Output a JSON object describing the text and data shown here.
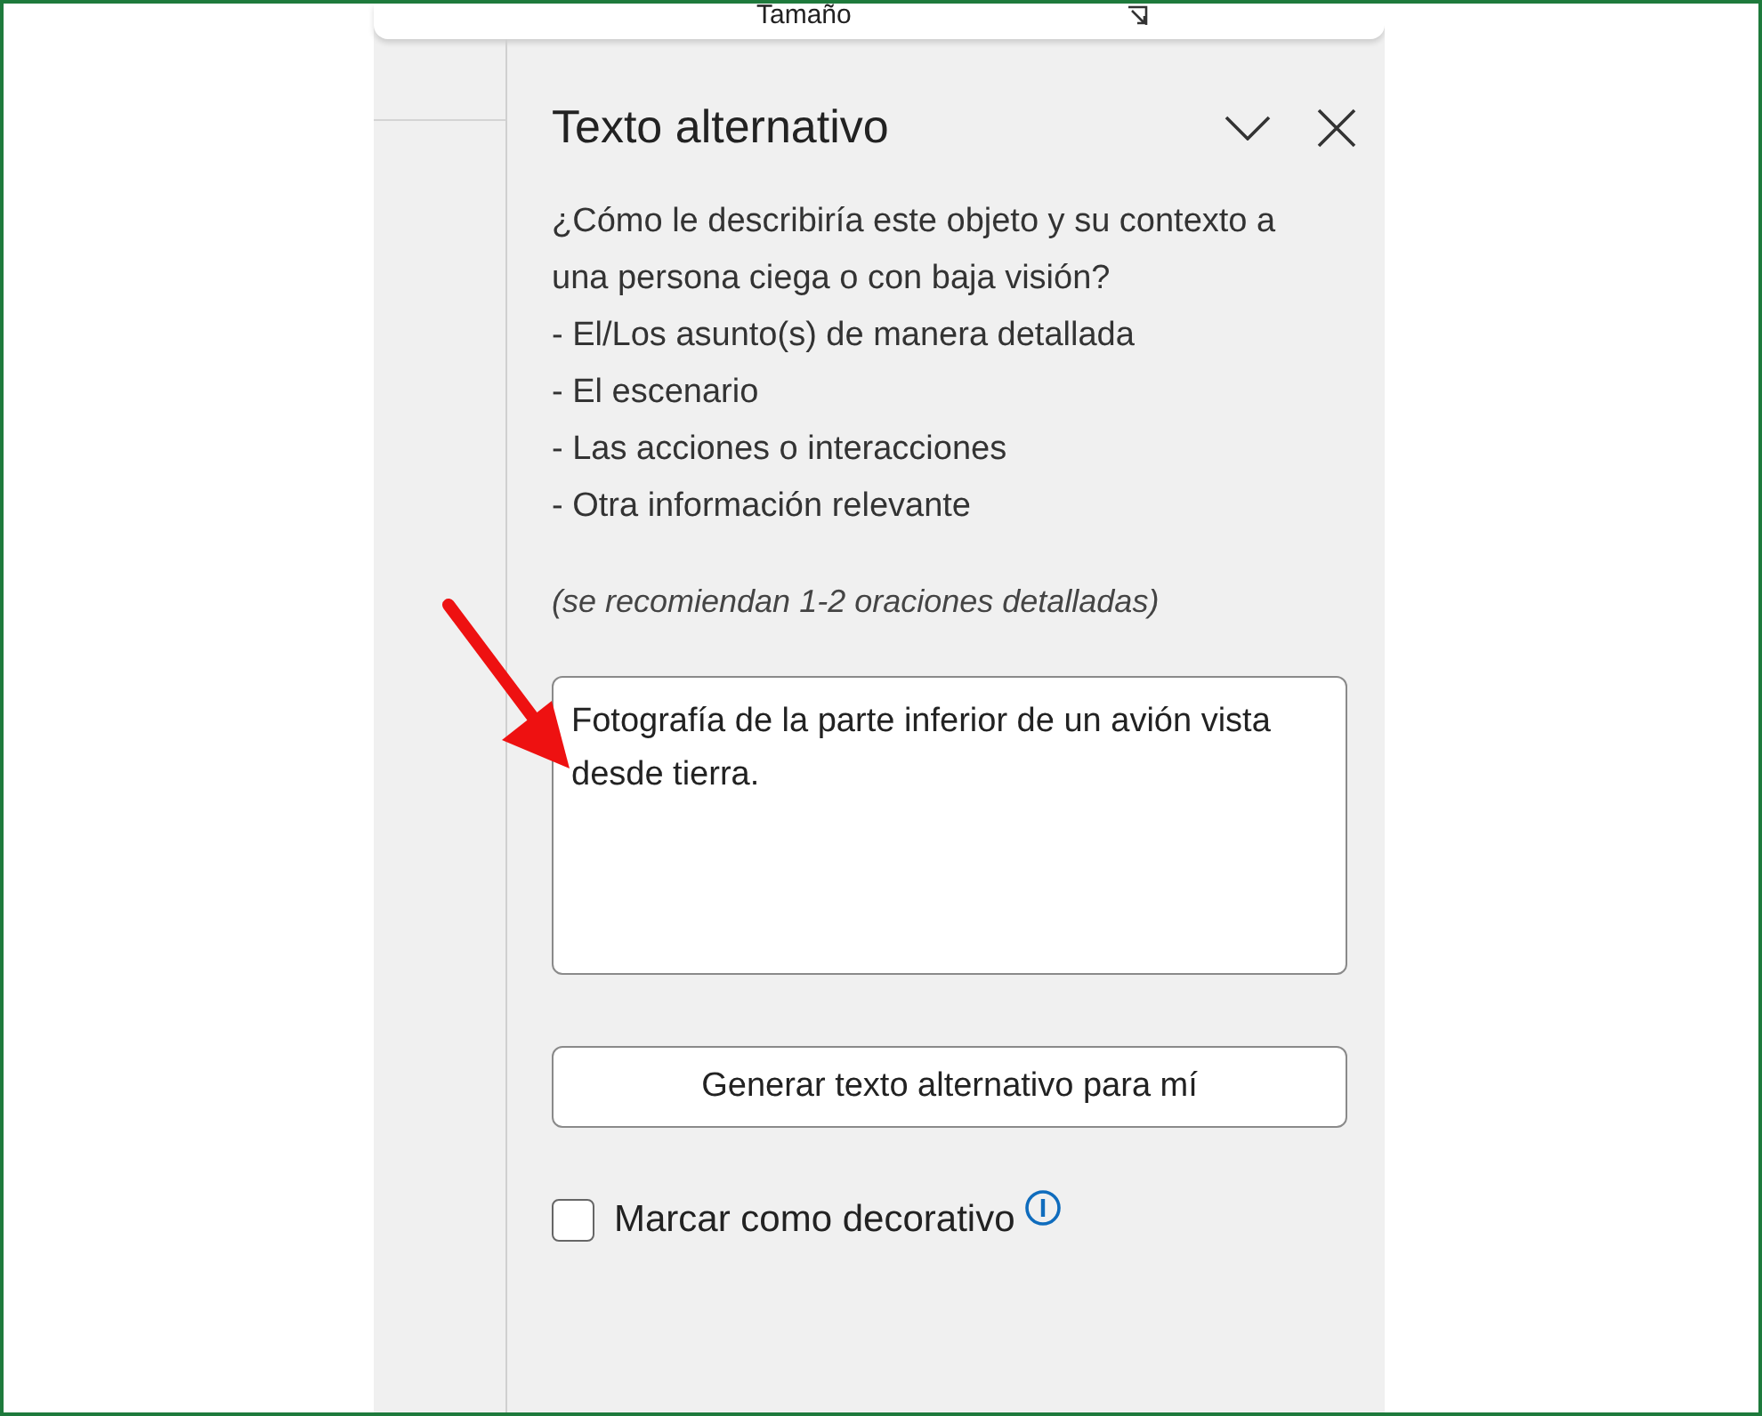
{
  "ribbon": {
    "label": "Tamaño"
  },
  "panel": {
    "title": "Texto alternativo",
    "description": [
      "¿Cómo le describiría este objeto y su contexto a una persona ciega o con baja visión?",
      "- El/Los asunto(s) de manera detallada",
      "- El escenario",
      "- Las acciones o interacciones",
      "- Otra información relevante"
    ],
    "hint": "(se recomiendan 1-2 oraciones detalladas)",
    "alt_text": {
      "value": "Fotografía de la parte inferior de un avión vista desde tierra."
    },
    "generate_button": "Generar texto alternativo para mí",
    "decorative": {
      "label": "Marcar como decorativo",
      "checked": false
    }
  }
}
